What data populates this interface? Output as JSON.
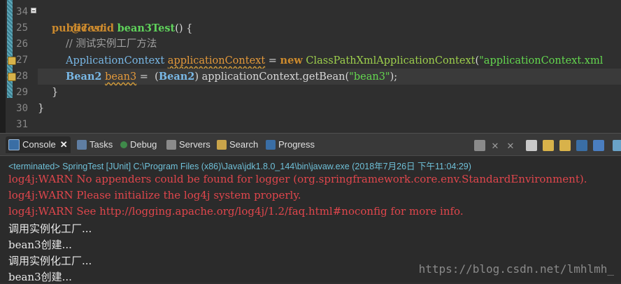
{
  "editor": {
    "line_numbers": [
      "34",
      "25",
      "26",
      "27",
      "28",
      "29",
      "30",
      "31"
    ],
    "code": {
      "l1_annotation": "@Test",
      "l2_kw1": "public",
      "l2_kw2": "void",
      "l2_method": "bean3Test",
      "l2_rest": "() {",
      "l3_comment": "// 测试实例工厂方法",
      "l4_type": "ApplicationContext",
      "l4_var": "applicationContext",
      "l4_eq": " = ",
      "l4_new": "new",
      "l4_class": "ClassPathXmlApplicationContext",
      "l4_open": "(",
      "l4_str": "\"applicationContext.xml",
      "l5_type": "Bean2",
      "l5_var": "bean3",
      "l5_mid1": " =  (",
      "l5_cast": "Bean2",
      "l5_mid2": ") applicationContext.getBean(",
      "l5_str": "\"bean3\"",
      "l5_end": ");",
      "l6_brace": "}",
      "l7_brace": "}"
    }
  },
  "tabs": {
    "console": "Console",
    "tasks": "Tasks",
    "debug": "Debug",
    "servers": "Servers",
    "search": "Search",
    "progress": "Progress"
  },
  "console": {
    "terminated": "<terminated> SpringTest [JUnit] C:\\Program Files (x86)\\Java\\jdk1.8.0_144\\bin\\javaw.exe (2018年7月26日 下午11:04:29)",
    "lines": [
      "log4j:WARN No appenders could be found for logger (org.springframework.core.env.StandardEnvironment).",
      "log4j:WARN Please initialize the log4j system properly.",
      "log4j:WARN See http://logging.apache.org/log4j/1.2/faq.html#noconfig for more info.",
      "调用实例化工厂...",
      "bean3创建...",
      "调用实例化工厂...",
      "bean3创建..."
    ],
    "watermark": "https://blog.csdn.net/lmhlmh_"
  },
  "colors": {
    "warn": "#e0464c",
    "keyword": "#cc8a2d",
    "method": "#5fd35b",
    "string": "#64d84f",
    "class": "#79b8e6"
  }
}
